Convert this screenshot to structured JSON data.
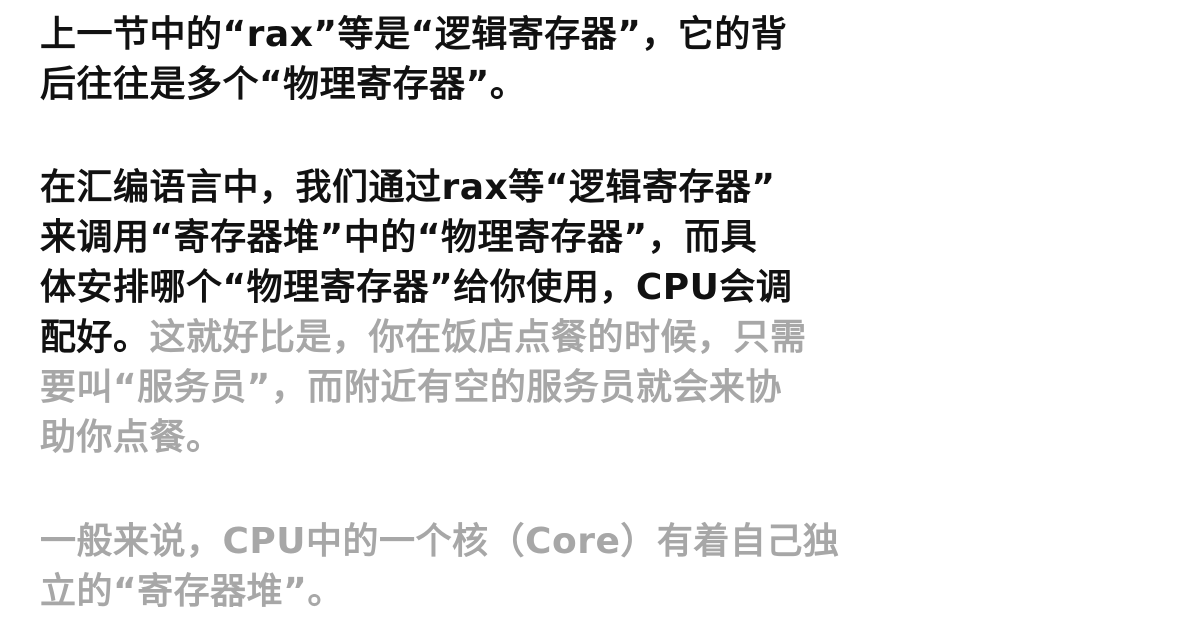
{
  "paragraphs": [
    {
      "lines": [
        {
          "dark": "上一节中的“rax”等是“逻辑寄存器”，它的背",
          "light": ""
        },
        {
          "dark": "后往往是多个“物理寄存器”。",
          "light": ""
        }
      ]
    },
    {
      "lines": [
        {
          "dark": "在汇编语言中，我们通过rax等“逻辑寄存器”",
          "light": ""
        },
        {
          "dark": "来调用“寄存器堆”中的“物理寄存器”，而具",
          "light": ""
        },
        {
          "dark": "体安排哪个“物理寄存器”给你使用，CPU会调",
          "light": ""
        },
        {
          "dark": "配好。",
          "light": "这就好比是，你在饭店点餐的时候，只需"
        },
        {
          "dark": "",
          "light": "要叫“服务员”，而附近有空的服务员就会来协"
        },
        {
          "dark": "",
          "light": "助你点餐。"
        }
      ]
    },
    {
      "lines": [
        {
          "dark": "",
          "light": "一般来说，CPU中的一个核（Core）有着自己独"
        },
        {
          "dark": "",
          "light": "立的“寄存器堆”。"
        }
      ]
    }
  ]
}
